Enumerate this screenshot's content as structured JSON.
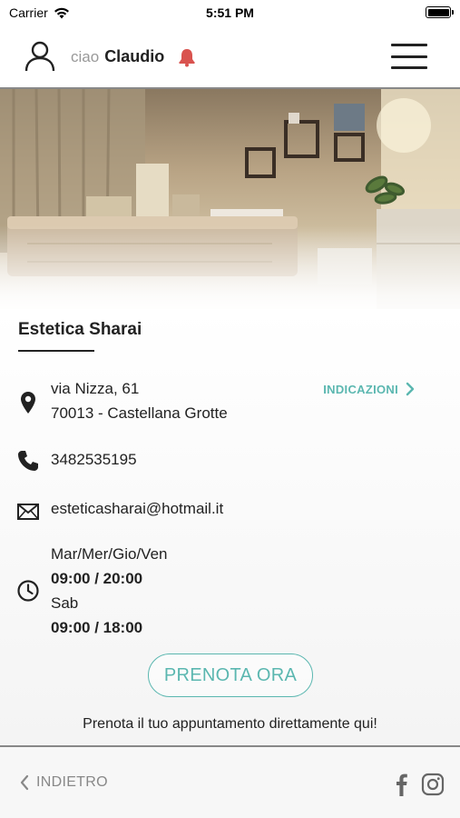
{
  "status_bar": {
    "carrier": "Carrier",
    "time": "5:51 PM"
  },
  "header": {
    "greeting_prefix": "ciao",
    "user_name": "Claudio",
    "bell_color": "#d9534f"
  },
  "business": {
    "name": "Estetica Sharai",
    "address_line1": "via Nizza, 61",
    "address_line2": "70013 - Castellana Grotte",
    "directions_label": "INDICAZIONI",
    "phone": "3482535195",
    "email": "esteticasharai@hotmail.it",
    "hours": [
      {
        "days": "Mar/Mer/Gio/Ven",
        "time": "09:00 / 20:00"
      },
      {
        "days": "Sab",
        "time": "09:00 / 18:00"
      }
    ]
  },
  "booking": {
    "button_label": "PRENOTA ORA",
    "note": "Prenota il tuo appuntamento direttamente qui!"
  },
  "footer": {
    "back_label": "INDIETRO"
  },
  "colors": {
    "accent": "#5bb7b0",
    "text": "#222222",
    "muted": "#888888"
  }
}
